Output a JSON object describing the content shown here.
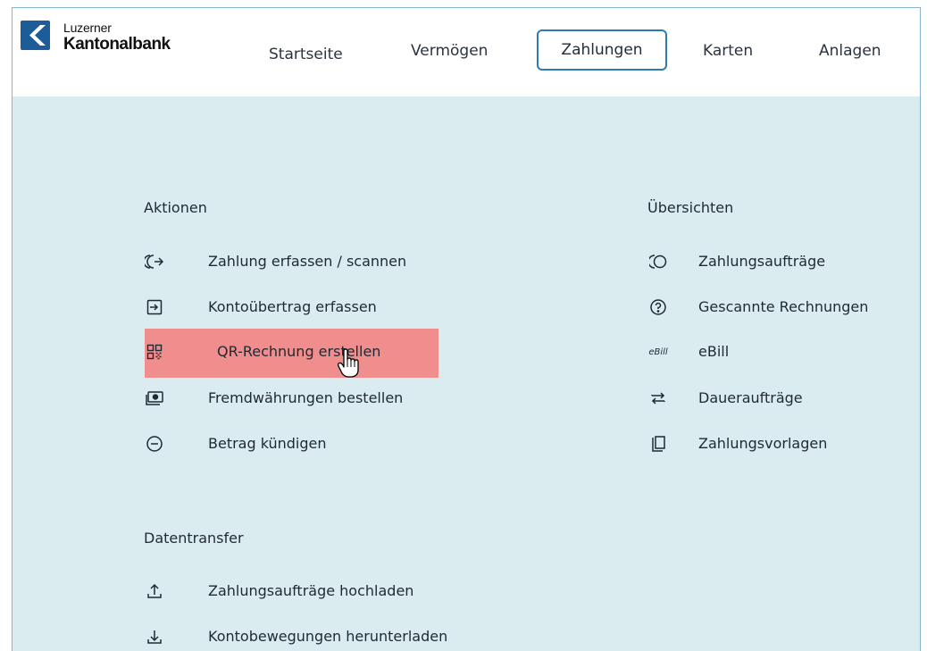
{
  "header": {
    "logo_line1": "Luzerner",
    "logo_line2": "Kantonalbank",
    "nav": [
      {
        "label": "Startseite"
      },
      {
        "label": "Vermögen"
      },
      {
        "label": "Zahlungen",
        "active": true
      },
      {
        "label": "Karten"
      },
      {
        "label": "Anlagen"
      }
    ]
  },
  "sections": {
    "aktionen": {
      "title": "Aktionen",
      "items": [
        {
          "label": "Zahlung erfassen / scannen",
          "icon": "scan-payment-icon"
        },
        {
          "label": "Kontoübertrag erfassen",
          "icon": "transfer-icon"
        },
        {
          "label": "QR-Rechnung erstellen",
          "icon": "qr-code-icon",
          "highlighted": true
        },
        {
          "label": "Fremdwährungen bestellen",
          "icon": "banknote-icon"
        },
        {
          "label": "Betrag kündigen",
          "icon": "minus-circle-icon"
        }
      ]
    },
    "uebersichten": {
      "title": "Übersichten",
      "items": [
        {
          "label": "Zahlungsaufträge",
          "icon": "payment-orders-icon"
        },
        {
          "label": "Gescannte Rechnungen",
          "icon": "question-circle-icon"
        },
        {
          "label": "eBill",
          "icon": "ebill-icon",
          "icon_text": "eBill"
        },
        {
          "label": "Daueraufträge",
          "icon": "repeat-icon"
        },
        {
          "label": "Zahlungsvorlagen",
          "icon": "templates-icon"
        }
      ]
    },
    "datentransfer": {
      "title": "Datentransfer",
      "items": [
        {
          "label": "Zahlungsaufträge hochladen",
          "icon": "upload-icon"
        },
        {
          "label": "Kontobewegungen herunterladen",
          "icon": "download-icon"
        }
      ]
    }
  },
  "colors": {
    "panel_bg": "#dbecf0",
    "active_border": "#2f7ab0",
    "highlight": "#f08d8d",
    "logo_blue": "#1c5d99"
  }
}
